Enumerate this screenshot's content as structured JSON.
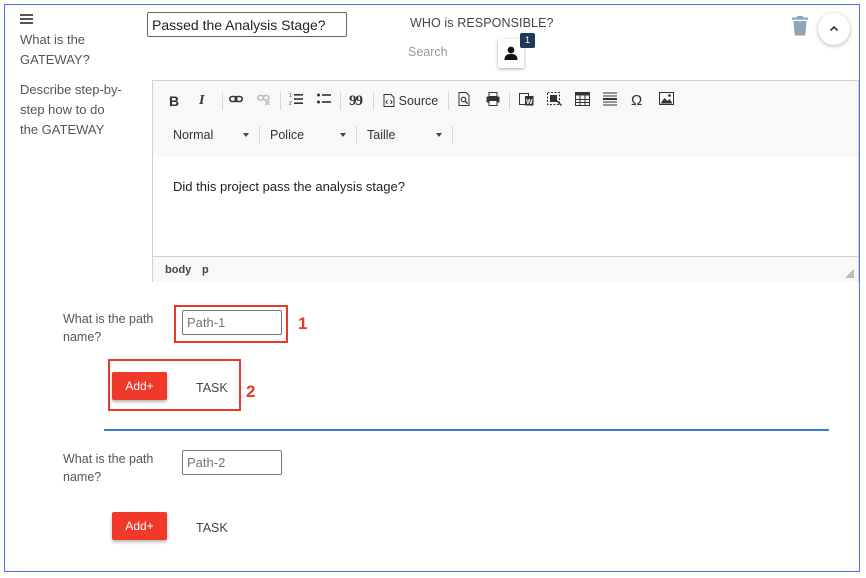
{
  "gateway": {
    "question_label": "What is the GATEWAY?",
    "title_value": "Passed the Analysis Stage?",
    "responsible_label": "WHO is RESPONSIBLE?",
    "search_placeholder": "Search",
    "responsible_count": "1",
    "describe_label": "Describe step-by-step how to do the GATEWAY"
  },
  "editor": {
    "toolbar": {
      "bold": "B",
      "italic": "I",
      "quote": "99",
      "source_label": "Source",
      "omega": "Ω",
      "format_combo": "Normal",
      "font_combo": "Police",
      "size_combo": "Taille"
    },
    "content": "Did this project pass the analysis stage?",
    "statusbar": [
      "body",
      "p"
    ]
  },
  "paths": [
    {
      "label": "What is the path name?",
      "placeholder": "Path-1",
      "add_label": "Add+",
      "task_label": "TASK"
    },
    {
      "label": "What is the path name?",
      "placeholder": "Path-2",
      "add_label": "Add+",
      "task_label": "TASK"
    }
  ],
  "annotations": [
    "1",
    "2"
  ],
  "colors": {
    "accent_blue": "#3b7dd8",
    "add_red": "#f0392b",
    "annotation_red": "#e43a2d",
    "badge_navy": "#1f3b5c"
  }
}
